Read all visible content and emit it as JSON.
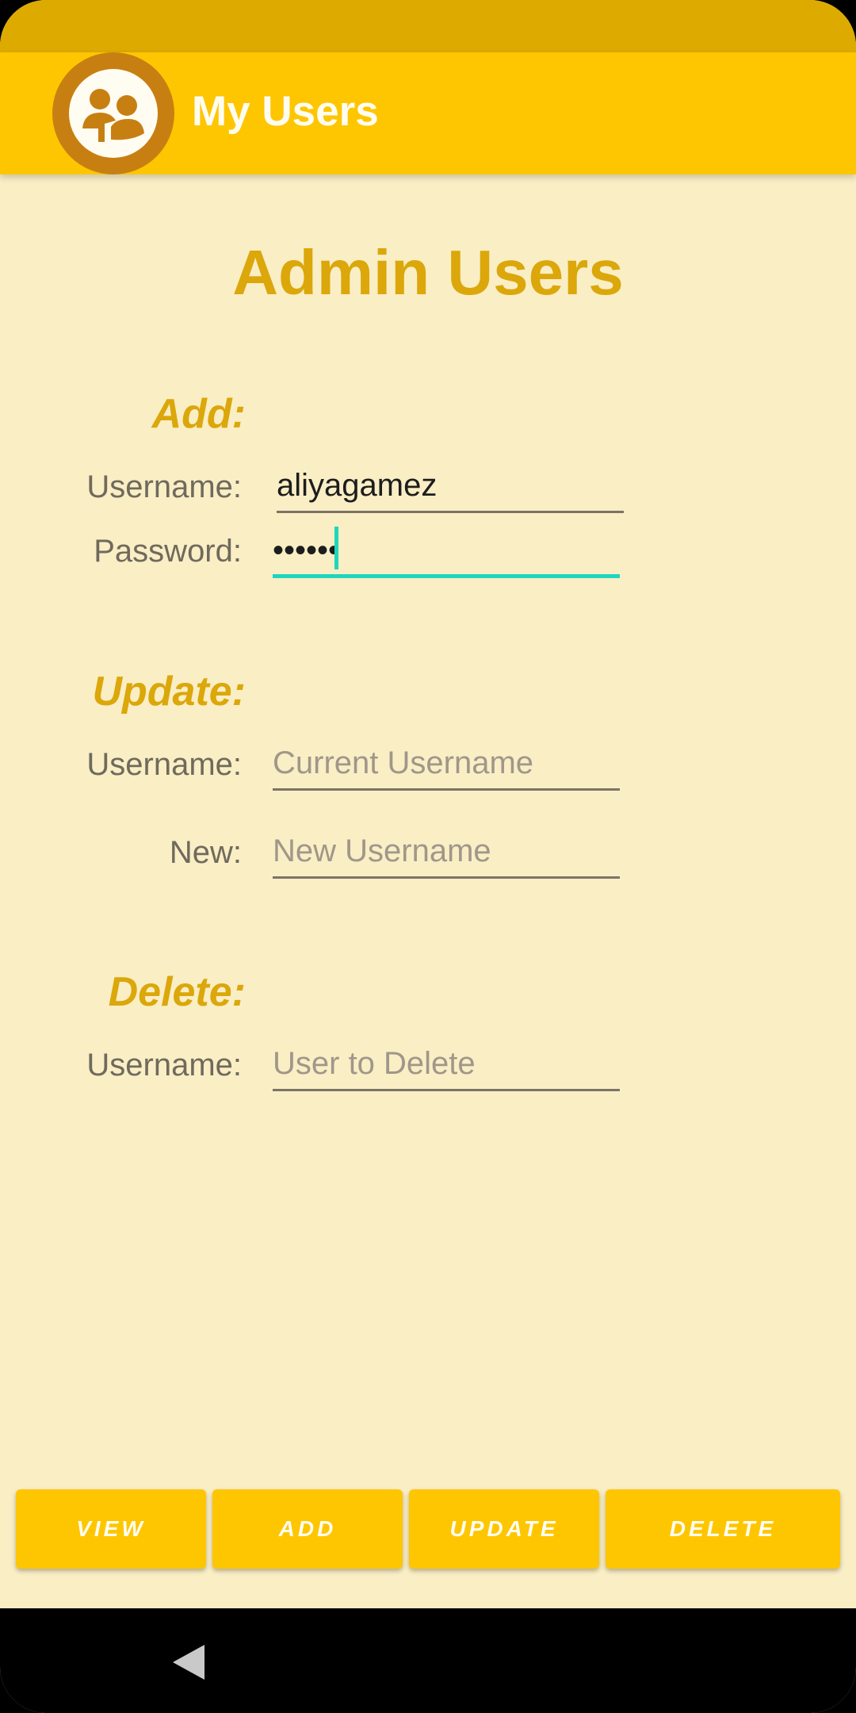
{
  "app_bar": {
    "title": "My Users",
    "logo_icon": "users-group-icon"
  },
  "page": {
    "title": "Admin Users"
  },
  "add_section": {
    "heading": "Add:",
    "username_label": "Username:",
    "username_value": "aliyagamez",
    "password_label": "Password:",
    "password_value": "••••••"
  },
  "update_section": {
    "heading": "Update:",
    "username_label": "Username:",
    "username_placeholder": "Current Username",
    "new_label": "New:",
    "new_placeholder": "New Username"
  },
  "delete_section": {
    "heading": "Delete:",
    "username_label": "Username:",
    "username_placeholder": "User to Delete"
  },
  "buttons": {
    "view": "VIEW",
    "add": "ADD",
    "update": "UPDATE",
    "delete": "DELETE"
  },
  "nav": {
    "back_icon": "back-triangle-icon"
  },
  "colors": {
    "status_bar": "#ddab00",
    "app_bar": "#fec600",
    "background": "#faeec5",
    "heading": "#dba70a",
    "focus_accent": "#1fd6bd",
    "logo": "#c87f12"
  }
}
